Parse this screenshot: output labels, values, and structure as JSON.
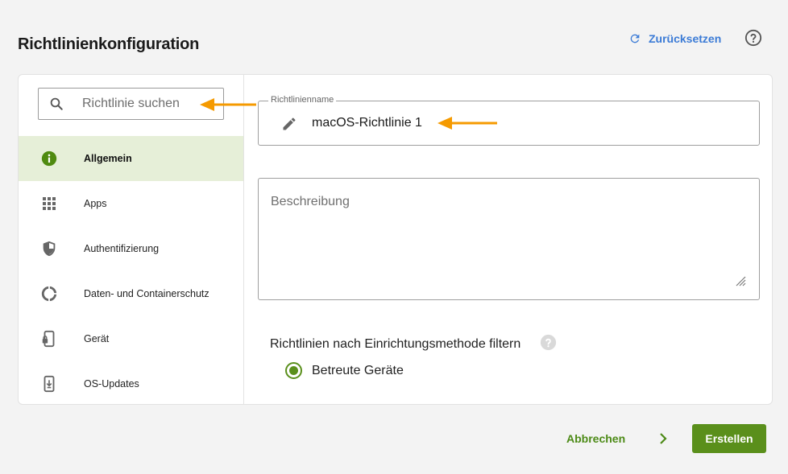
{
  "header": {
    "title": "Richtlinienkonfiguration",
    "reset_label": "Zurücksetzen"
  },
  "sidebar": {
    "search_placeholder": "Richtlinie suchen",
    "items": [
      {
        "label": "Allgemein",
        "icon": "info-icon",
        "active": true
      },
      {
        "label": "Apps",
        "icon": "apps-grid-icon",
        "active": false
      },
      {
        "label": "Authentifizierung",
        "icon": "shield-icon",
        "active": false
      },
      {
        "label": "Daten- und Containerschutz",
        "icon": "data-circle-icon",
        "active": false
      },
      {
        "label": "Gerät",
        "icon": "device-lock-icon",
        "active": false
      },
      {
        "label": "OS-Updates",
        "icon": "device-download-icon",
        "active": false
      }
    ]
  },
  "form": {
    "name_label": "Richtlinienname",
    "name_value": "macOS-Richtlinie 1",
    "description_placeholder": "Beschreibung",
    "filter_label": "Richtlinien nach Einrichtungsmethode filtern",
    "radio_label": "Betreute Geräte"
  },
  "footer": {
    "cancel_label": "Abbrechen",
    "create_label": "Erstellen"
  },
  "colors": {
    "accent_green": "#5a8f1b",
    "active_bg": "#e6efd8",
    "link_blue": "#3b7bd6",
    "annotation_orange": "#f59a00"
  }
}
